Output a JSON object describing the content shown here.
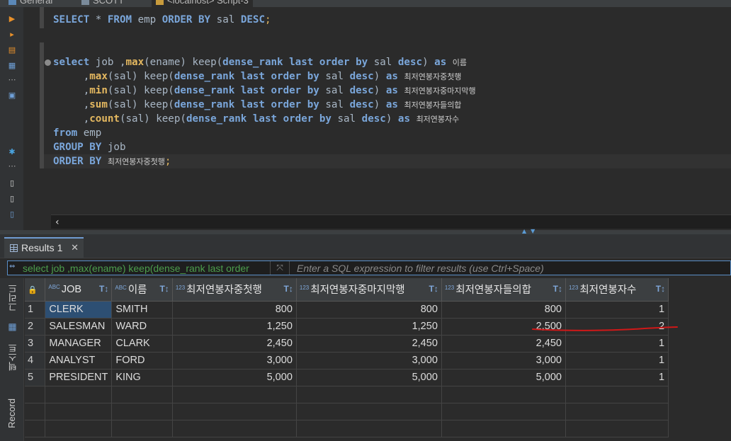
{
  "tabs": [
    {
      "label": "General"
    },
    {
      "label": "SCOTT"
    },
    {
      "label": "<localhost> Script-3"
    }
  ],
  "editor": {
    "lines": [
      "SELECT * FROM emp ORDER BY sal DESC;",
      "select job ,max(ename) keep(dense_rank last order by sal desc) as 이름",
      ",max(sal) keep(dense_rank last order by sal desc) as 최저연봉자중첫행",
      ",min(sal) keep(dense_rank last order by sal desc) as 최저연봉자중마지막행",
      ",sum(sal) keep(dense_rank last order by sal desc) as 최저연봉자들의합",
      ",count(sal) keep(dense_rank last order by sal desc) as 최저연봉자수",
      "from emp",
      "GROUP BY job",
      "ORDER BY 최저연봉자중첫행;"
    ]
  },
  "results": {
    "tab_label": "Results 1",
    "filter_sql": "select job ,max(ename) keep(dense_rank last order",
    "filter_placeholder": "Enter a SQL expression to filter results (use Ctrl+Space)",
    "side_tabs": [
      "그리드",
      "텍스트",
      "Record"
    ],
    "columns": [
      {
        "type": "ABC",
        "label": "JOB"
      },
      {
        "type": "ABC",
        "label": "이름"
      },
      {
        "type": "123",
        "label": "최저연봉자중첫행"
      },
      {
        "type": "123",
        "label": "최저연봉자중마지막행"
      },
      {
        "type": "123",
        "label": "최저연봉자들의합"
      },
      {
        "type": "123",
        "label": "최저연봉자수"
      }
    ],
    "rows": [
      [
        "1",
        "CLERK",
        "SMITH",
        "800",
        "800",
        "800",
        "1"
      ],
      [
        "2",
        "SALESMAN",
        "WARD",
        "1,250",
        "1,250",
        "2,500",
        "2"
      ],
      [
        "3",
        "MANAGER",
        "CLARK",
        "2,450",
        "2,450",
        "2,450",
        "1"
      ],
      [
        "4",
        "ANALYST",
        "FORD",
        "3,000",
        "3,000",
        "3,000",
        "1"
      ],
      [
        "5",
        "PRESIDENT",
        "KING",
        "5,000",
        "5,000",
        "5,000",
        "1"
      ]
    ],
    "annotation_color": "#d01818"
  }
}
